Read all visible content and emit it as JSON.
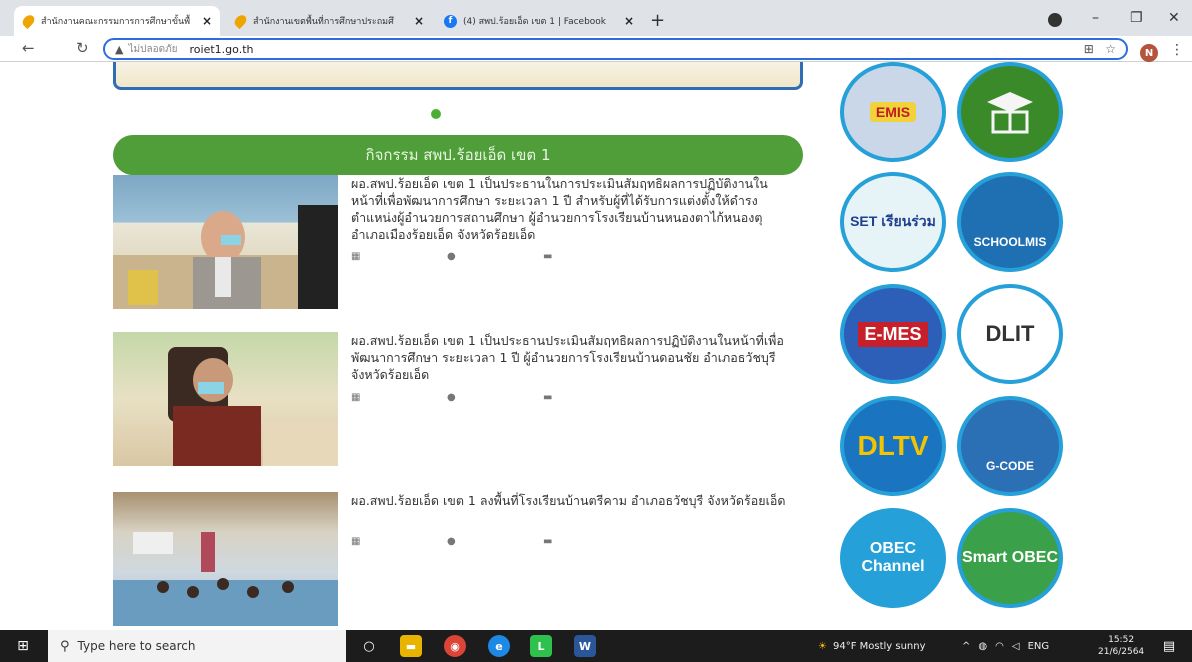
{
  "browser": {
    "tabs": [
      {
        "title": "สำนักงานคณะกรรมการการศึกษาขั้นพื้",
        "icon": "drop-icon"
      },
      {
        "title": "สำนักงานเขตพื้นที่การศึกษาประถมศึ",
        "icon": "drop-icon"
      },
      {
        "title": "(4) สพป.ร้อยเอ็ด เขต 1 | Facebook",
        "icon": "facebook-icon"
      }
    ],
    "new_tab": "+",
    "security_label": "ไม่ปลอดภัย",
    "url": "roiet1.go.th",
    "profile_initial": "N"
  },
  "page": {
    "section_title": "กิจกรรม สพป.ร้อยเอ็ด เขต 1",
    "news": [
      {
        "text": "ผอ.สพป.ร้อยเอ็ด เขต 1 เป็นประธานในการประเมินสัมฤทธิผลการปฏิบัติงานในหน้าที่เพื่อพัฒนาการศึกษา ระยะเวลา 1 ปี สำหรับผู้ที่ได้รับการแต่งตั้งให้ดำรงตำแหน่งผู้อำนวยการสถานศึกษา ผู้อำนวยการโรงเรียนบ้านหนองตาไก้หนองตุ อำเภอเมืองร้อยเอ็ด จังหวัดร้อยเอ็ด"
      },
      {
        "text": "ผอ.สพป.ร้อยเอ็ด เขต 1 เป็นประธานประเมินสัมฤทธิผลการปฏิบัติงานในหน้าที่เพื่อพัฒนาการศึกษา ระยะเวลา 1 ปี ผู้อำนวยการโรงเรียนบ้านดอนชัย อำเภอธวัชบุรี จังหวัดร้อยเอ็ด"
      },
      {
        "text": "ผอ.สพป.ร้อยเอ็ด เขต 1 ลงพื้นที่โรงเรียนบ้านตรีคาม อำเภอธวัชบุรี จังหวัดร้อยเอ็ด"
      }
    ],
    "meta_icons": [
      "calendar-icon",
      "user-icon",
      "folder-icon"
    ]
  },
  "sidebar_links": [
    {
      "label": "EMIS",
      "bg": "#c9d7e8",
      "fg": "#c01e1e"
    },
    {
      "label": "",
      "bg": "#3a8a2a",
      "fg": "#ffffff"
    },
    {
      "label": "SET เรียนร่วม",
      "bg": "#e6f4f8",
      "fg": "#1f3f8f"
    },
    {
      "label": "SCHOOLMIS",
      "bg": "#1f6fb3",
      "fg": "#ffffff"
    },
    {
      "label": "E-MES",
      "bg": "#2d5fb8",
      "fg": "#ffffff"
    },
    {
      "label": "DLIT",
      "bg": "#ffffff",
      "fg": "#333333"
    },
    {
      "label": "DLTV",
      "bg": "#1a74c0",
      "fg": "#f5c400"
    },
    {
      "label": "G-CODE",
      "bg": "#2b6fb5",
      "fg": "#ffffff"
    },
    {
      "label": "OBEC Channel",
      "bg": "#25a0d8",
      "fg": "#ffffff"
    },
    {
      "label": "Smart OBEC",
      "bg": "#3aa04a",
      "fg": "#ffffff"
    }
  ],
  "taskbar": {
    "search_placeholder": "Type here to search",
    "weather": "94°F  Mostly sunny",
    "lang": "ENG",
    "time": "15:52",
    "date": "21/6/2564"
  }
}
